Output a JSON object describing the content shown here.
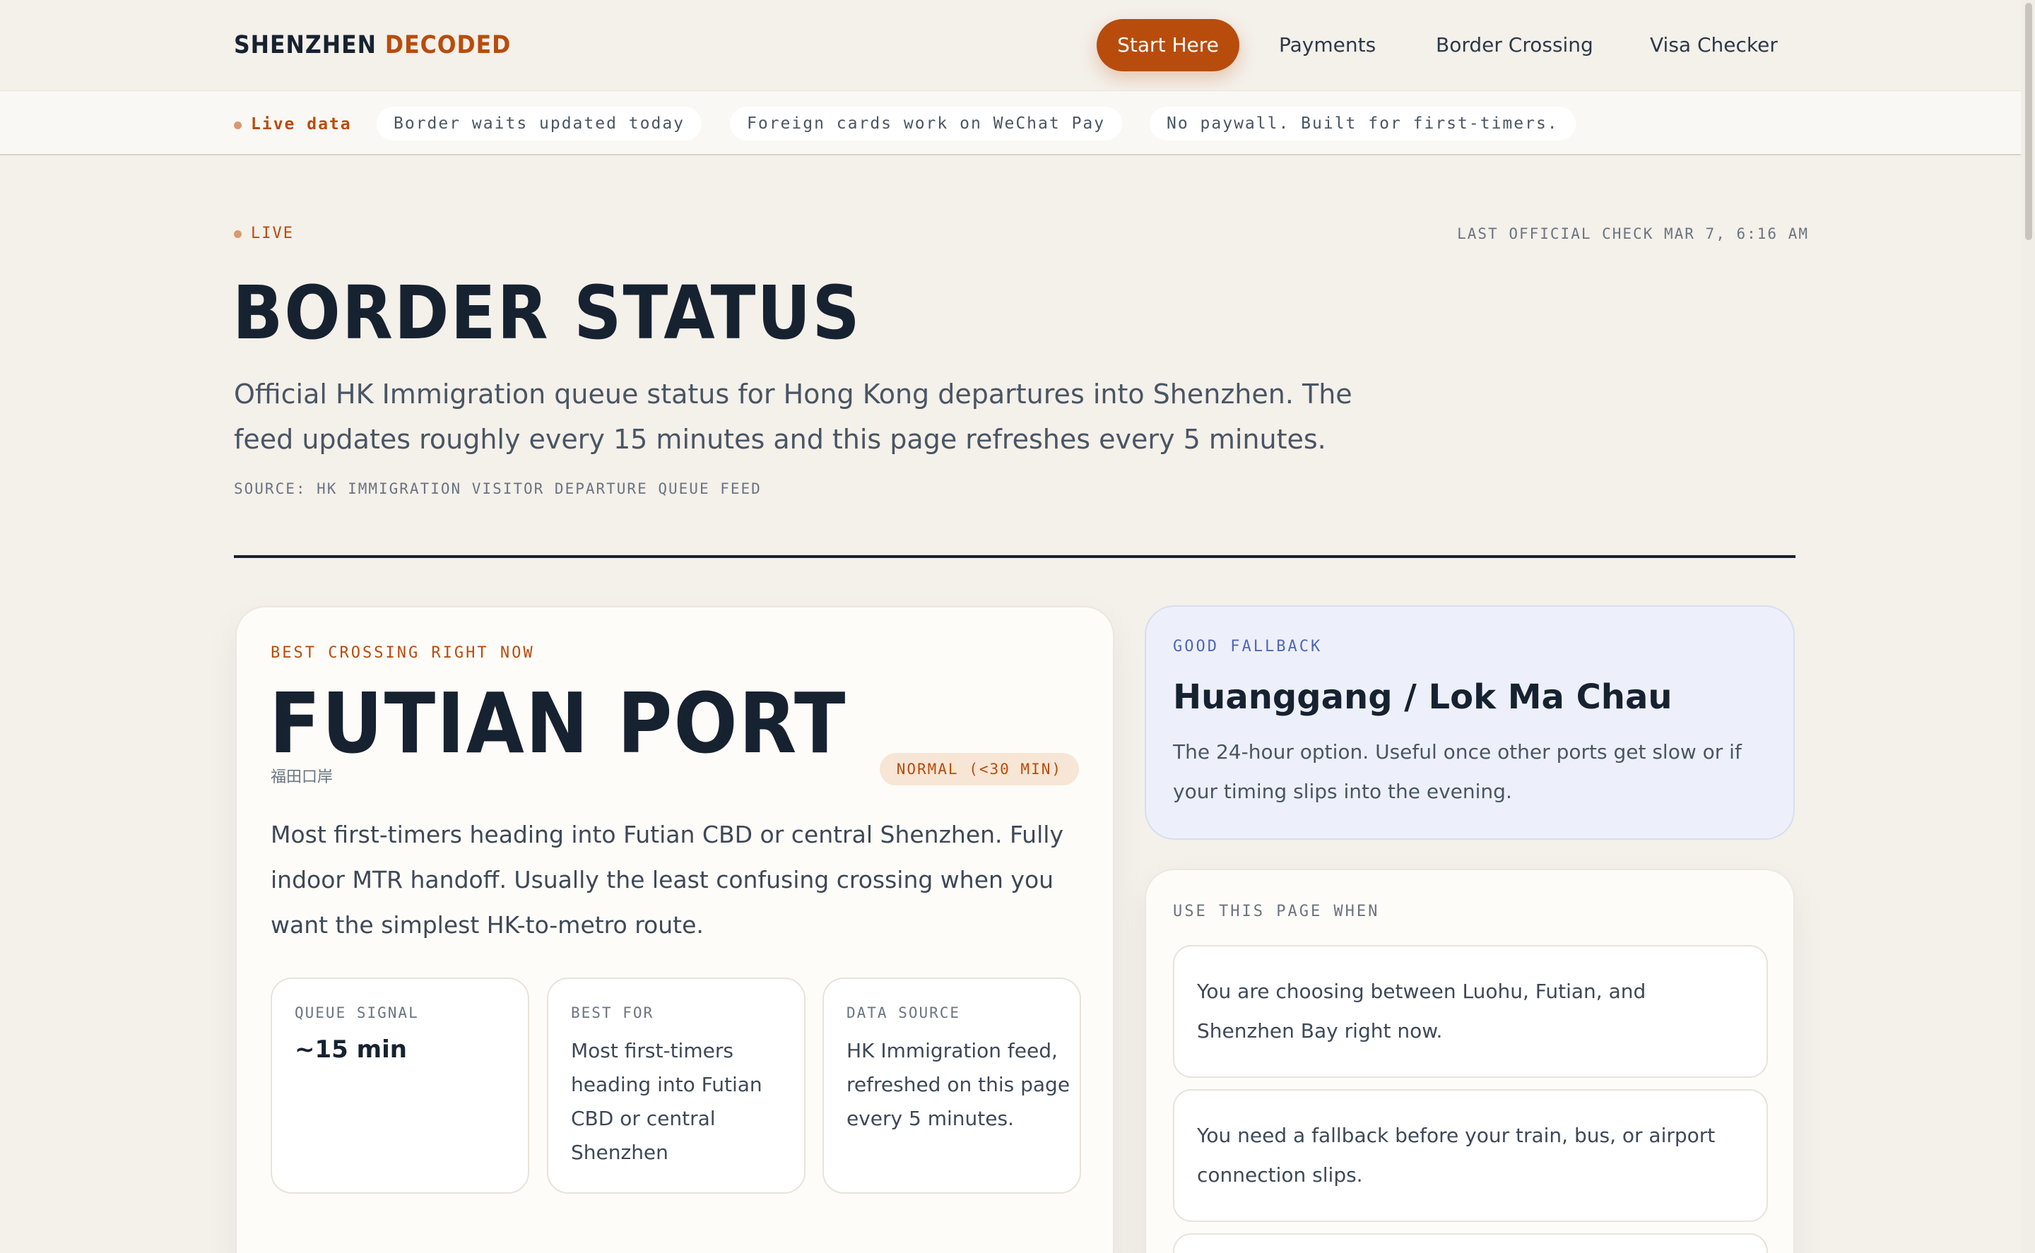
{
  "header": {
    "logo_main": "SHENZHEN",
    "logo_accent": "DECODED",
    "nav": [
      "Start Here",
      "Payments",
      "Border Crossing",
      "Visa Checker"
    ]
  },
  "ticker": {
    "live": "Live data",
    "pills": [
      "Border waits updated today",
      "Foreign cards work on WeChat Pay",
      "No paywall. Built for first-timers."
    ]
  },
  "status": {
    "live_tag": "LIVE",
    "last_check": "LAST OFFICIAL CHECK MAR 7, 6:16 AM",
    "title": "BORDER STATUS",
    "description": "Official HK Immigration queue status for Hong Kong departures into Shenzhen. The feed updates roughly every 15 minutes and this page refreshes every 5 minutes.",
    "source": "SOURCE: HK IMMIGRATION VISITOR DEPARTURE QUEUE FEED"
  },
  "best": {
    "eyebrow": "BEST CROSSING RIGHT NOW",
    "name": "FUTIAN PORT",
    "name_cn": "福田口岸",
    "badge": "NORMAL (<30 MIN)",
    "description": "Most first-timers heading into Futian CBD or central Shenzhen. Fully indoor MTR handoff. Usually the least confusing crossing when you want the simplest HK-to-metro route.",
    "stats": [
      {
        "label": "QUEUE SIGNAL",
        "value": "~15 min"
      },
      {
        "label": "BEST FOR",
        "value": "Most first-timers heading into Futian CBD or central Shenzhen"
      },
      {
        "label": "DATA SOURCE",
        "value": "HK Immigration feed, refreshed on this page every 5 minutes."
      }
    ],
    "accent_color": "#b84c0c"
  },
  "fallback": {
    "eyebrow": "GOOD FALLBACK",
    "title": "Huanggang / Lok Ma Chau",
    "description": "The 24-hour option. Useful once other ports get slow or if your timing slips into the evening."
  },
  "use_page": {
    "eyebrow": "USE THIS PAGE WHEN",
    "items": [
      "You are choosing between Luohu, Futian, and Shenzhen Bay right now.",
      "You need a fallback before your train, bus, or airport connection slips."
    ]
  }
}
